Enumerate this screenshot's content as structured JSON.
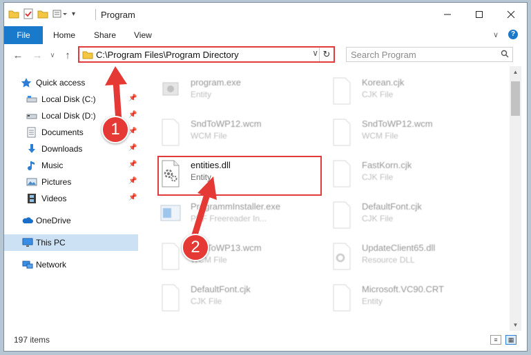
{
  "window": {
    "title": "Program"
  },
  "ribbon": {
    "tabs": [
      {
        "label": "File"
      },
      {
        "label": "Home"
      },
      {
        "label": "Share"
      },
      {
        "label": "View"
      }
    ]
  },
  "address": {
    "path": "C:\\Program Files\\Program Directory"
  },
  "search": {
    "placeholder": "Search Program"
  },
  "sidebar": {
    "items": [
      {
        "label": "Quick access",
        "icon": "star-icon"
      },
      {
        "label": "Local Disk (C:)",
        "icon": "drive-icon"
      },
      {
        "label": "Local Disk (D:)",
        "icon": "drive-icon"
      },
      {
        "label": "Documents",
        "icon": "documents-icon"
      },
      {
        "label": "Downloads",
        "icon": "download-arrow-icon"
      },
      {
        "label": "Music",
        "icon": "music-note-icon"
      },
      {
        "label": "Pictures",
        "icon": "pictures-icon"
      },
      {
        "label": "Videos",
        "icon": "film-icon"
      },
      {
        "label": "OneDrive",
        "icon": "cloud-icon"
      },
      {
        "label": "This PC",
        "icon": "monitor-icon"
      },
      {
        "label": "Network",
        "icon": "network-icon"
      }
    ]
  },
  "files": [
    {
      "name": "program.exe",
      "type": "Entity"
    },
    {
      "name": "Korean.cjk",
      "type": "CJK File"
    },
    {
      "name": "SndToWP12.wcm",
      "type": "WCM File"
    },
    {
      "name": "SndToWP12.wcm",
      "type": "WCM File"
    },
    {
      "name": "entities.dll",
      "type": "Entity"
    },
    {
      "name": "FastKorn.cjk",
      "type": "CJK File"
    },
    {
      "name": "ProgrammInstaller.exe",
      "type": "PDF Freereader In..."
    },
    {
      "name": "DefaultFont.cjk",
      "type": "CJK File"
    },
    {
      "name": "SndToWP13.wcm",
      "type": "WCM File"
    },
    {
      "name": "UpdateClient65.dll",
      "type": "Resource DLL"
    },
    {
      "name": "DefaultFont.cjk",
      "type": "CJK File"
    },
    {
      "name": "Microsoft.VC90.CRT",
      "type": "Entity"
    }
  ],
  "status": {
    "item_count": "197 items"
  },
  "annotations": {
    "step1": "1",
    "step2": "2",
    "accent": "#e53935"
  },
  "colors": {
    "file_tab": "#1979ca",
    "selection": "#cde1f4",
    "highlight_border": "#e03a3a"
  }
}
